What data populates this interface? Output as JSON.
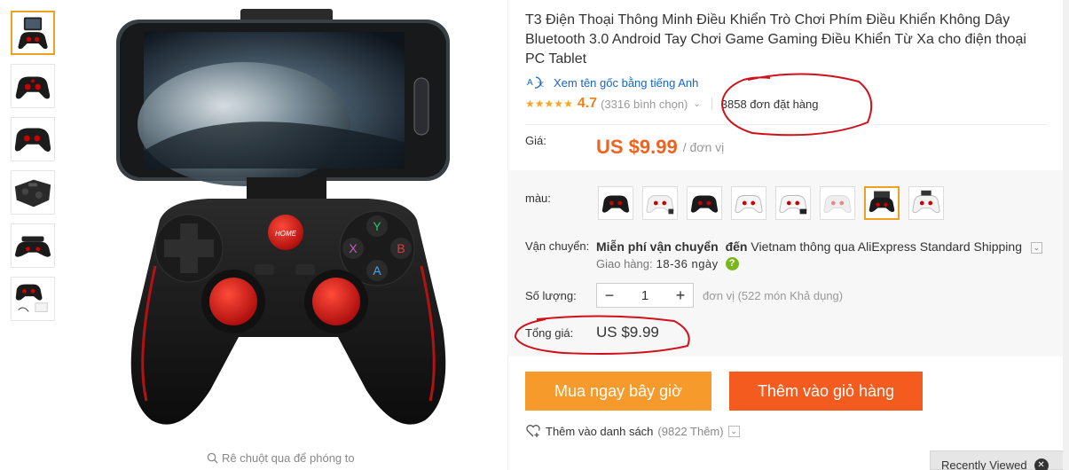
{
  "product": {
    "title": "T3 Điện Thoại Thông Minh Điều Khiển Trò Chơi Phím Điều Khiển Không Dây Bluetooth 3.0 Android Tay Chơi Game Gaming Điều Khiển Từ Xa cho điện thoại PC Tablet",
    "original_title_link": "Xem tên gốc bằng tiếng Anh",
    "rating": "4.7",
    "rating_stars": 4.7,
    "rating_count": "(3316 bình chọn)",
    "orders": "3858 đơn đặt hàng"
  },
  "gallery": {
    "zoom_hint": "Rê chuột qua để phóng to",
    "thumb_count": 6
  },
  "price": {
    "label": "Giá:",
    "value": "US $9.99",
    "unit": "/ đơn vị"
  },
  "color": {
    "label": "màu:",
    "options": 8,
    "selected_index": 6
  },
  "shipping": {
    "label": "Vận chuyển:",
    "free_text": "Miễn phí vận chuyển",
    "to_text": "đến",
    "destination": "Vietnam thông qua AliExpress Standard Shipping",
    "delivery_label": "Giao hàng:",
    "delivery_days": "18-36 ngày"
  },
  "quantity": {
    "label": "Số lượng:",
    "minus": "−",
    "value": "1",
    "plus": "+",
    "note": "đơn vị (522 món Khả dụng)"
  },
  "total": {
    "label": "Tổng giá:",
    "value": "US $9.99"
  },
  "actions": {
    "buy_now": "Mua ngay bây giờ",
    "add_to_cart": "Thêm vào giỏ hàng",
    "wishlist": "Thêm vào danh sách",
    "wishlist_count": "(9822 Thêm)"
  },
  "recently_viewed": "Recently Viewed",
  "colors": {
    "accent": "#f79a2c",
    "cart": "#f45b1e",
    "price": "#f0621e",
    "link": "#1266cc",
    "selected_border": "#f0a020",
    "annotation": "#d0101a"
  }
}
